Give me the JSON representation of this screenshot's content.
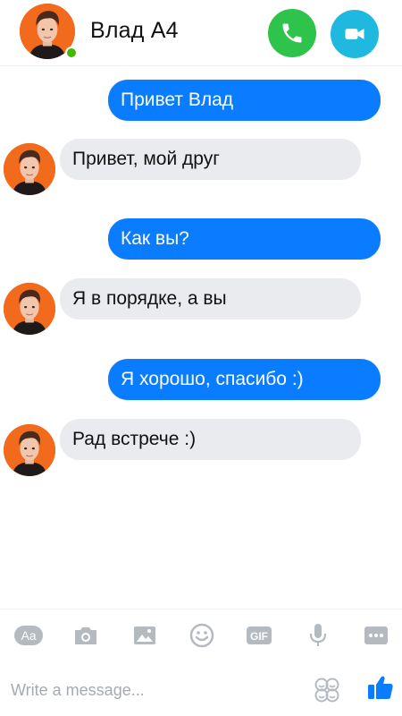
{
  "header": {
    "contact_name": "Влад А4",
    "online": true,
    "call_icon": "phone-icon",
    "video_icon": "video-camera-icon"
  },
  "messages": [
    {
      "direction": "outgoing",
      "text": "Привет Влад"
    },
    {
      "direction": "incoming",
      "text": "Привет, мой друг"
    },
    {
      "direction": "outgoing",
      "text": "Как вы?"
    },
    {
      "direction": "incoming",
      "text": "Я в порядке, а вы"
    },
    {
      "direction": "outgoing",
      "text": "Я хорошо, спасибо :)"
    },
    {
      "direction": "incoming",
      "text": "Рад встрече :)"
    }
  ],
  "toolbar": {
    "items": [
      "text-format-icon",
      "camera-icon",
      "image-icon",
      "emoji-icon",
      "gif-icon",
      "microphone-icon",
      "more-icon"
    ],
    "text_format_label": "Aa",
    "gif_label": "GIF"
  },
  "compose": {
    "placeholder": "Write a message..."
  },
  "colors": {
    "outgoing_bubble": "#0a7cff",
    "incoming_bubble": "#eaebee",
    "call_button": "#2ec34a",
    "video_button": "#1fb9df",
    "online_dot": "#44b700",
    "avatar_bg": "#f26a1b",
    "toolbar_icon": "#b5bac1",
    "like_icon": "#0a7cff"
  }
}
